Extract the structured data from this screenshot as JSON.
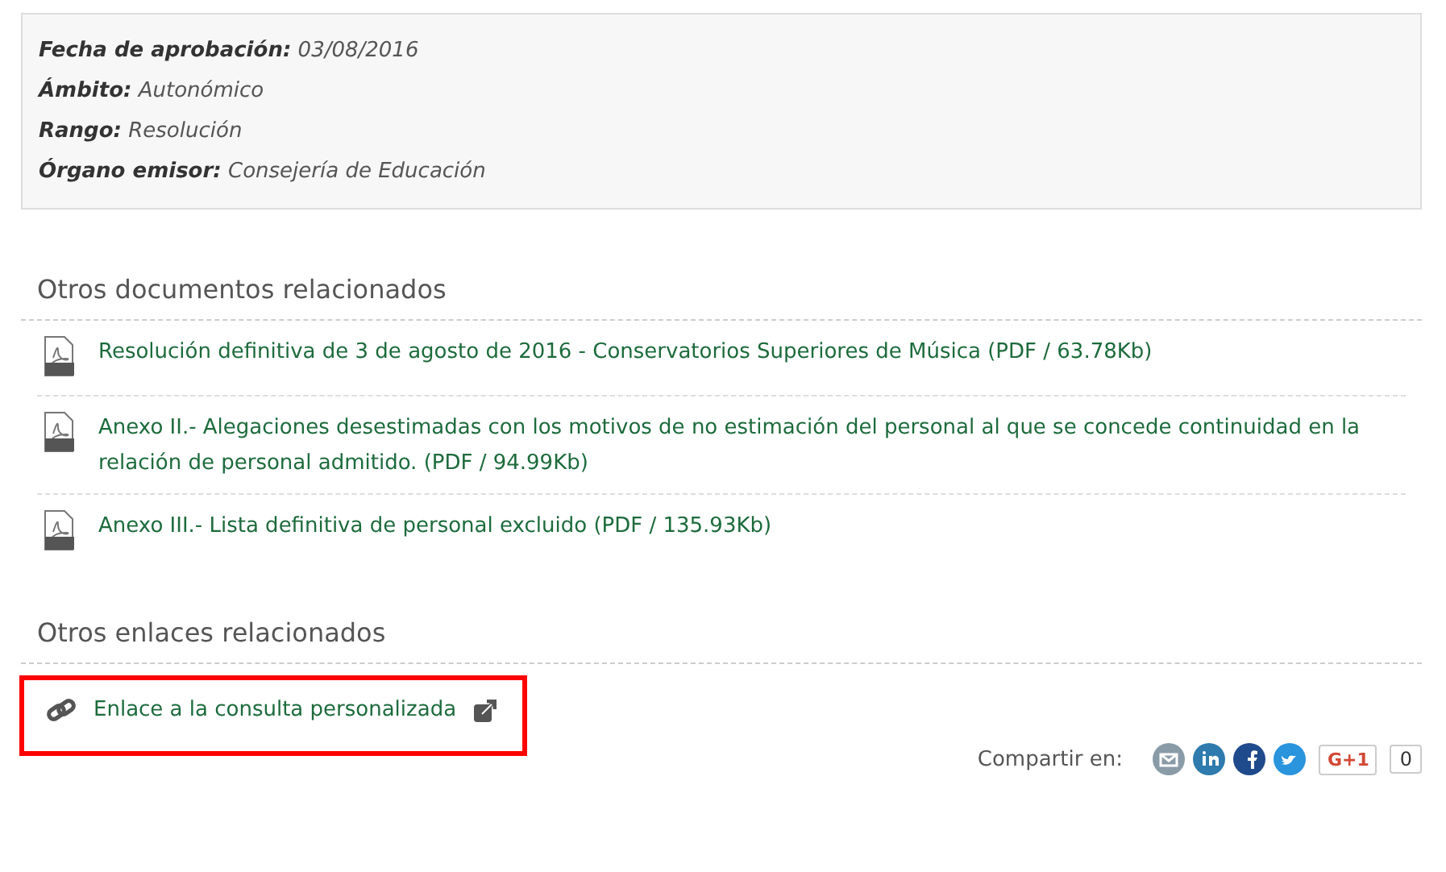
{
  "details": [
    {
      "label": "Fecha de aprobación:",
      "value": "03/08/2016"
    },
    {
      "label": "Ámbito:",
      "value": "Autonómico"
    },
    {
      "label": "Rango:",
      "value": "Resolución"
    },
    {
      "label": "Órgano emisor:",
      "value": "Consejería de Educación"
    }
  ],
  "documents": {
    "heading": "Otros documentos relacionados",
    "items": [
      {
        "text": "Resolución definitiva de 3 de agosto de 2016 - Conservatorios Superiores de Música (PDF / 63.78Kb)"
      },
      {
        "text": "Anexo II.- Alegaciones desestimadas con los motivos de no estimación del personal al que se concede continuidad en la relación de personal admitido. (PDF / 94.99Kb)"
      },
      {
        "text": "Anexo III.- Lista definitiva de personal excluido (PDF / 135.93Kb)"
      }
    ]
  },
  "links": {
    "heading": "Otros enlaces relacionados",
    "items": [
      {
        "text": "Enlace a la consulta personalizada",
        "highlighted": true,
        "external": true
      }
    ]
  },
  "share": {
    "label": "Compartir en:",
    "networks": [
      {
        "kind": "email",
        "color": "#8a9ba8"
      },
      {
        "kind": "linkedin",
        "color": "#2f7bad"
      },
      {
        "kind": "facebook",
        "color": "#1f4a8c"
      },
      {
        "kind": "twitter",
        "color": "#2a94dd"
      }
    ],
    "plus_button": "G+1",
    "count": "0"
  }
}
